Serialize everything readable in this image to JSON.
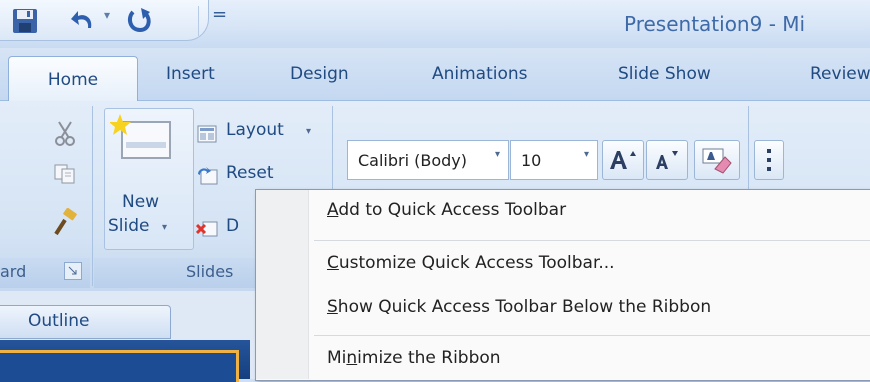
{
  "window": {
    "title": "Presentation9 - Mi"
  },
  "qat": {
    "more_glyph": "="
  },
  "tabs": [
    {
      "label": "Home"
    },
    {
      "label": "Insert"
    },
    {
      "label": "Design"
    },
    {
      "label": "Animations"
    },
    {
      "label": "Slide Show"
    },
    {
      "label": "Review"
    }
  ],
  "ribbon": {
    "clipboard": {
      "label_partial": "ard"
    },
    "slides": {
      "new_slide_line1": "New",
      "new_slide_line2": "Slide",
      "layout_label": "Layout",
      "reset_label": "Reset",
      "delete_label": "D",
      "group_label": "Slides"
    },
    "font": {
      "family": "Calibri (Body)",
      "size": "10"
    }
  },
  "panes": {
    "outline_tab": "Outline"
  },
  "context_menu": {
    "items": [
      {
        "mnemonic": "A",
        "rest": "dd to Quick Access Toolbar"
      },
      {
        "mnemonic": "C",
        "rest": "ustomize Quick Access Toolbar..."
      },
      {
        "mnemonic": "S",
        "rest": "how Quick Access Toolbar Below the Ribbon"
      },
      {
        "pre": "Mi",
        "mnemonic": "n",
        "rest": "imize the Ribbon"
      }
    ]
  }
}
